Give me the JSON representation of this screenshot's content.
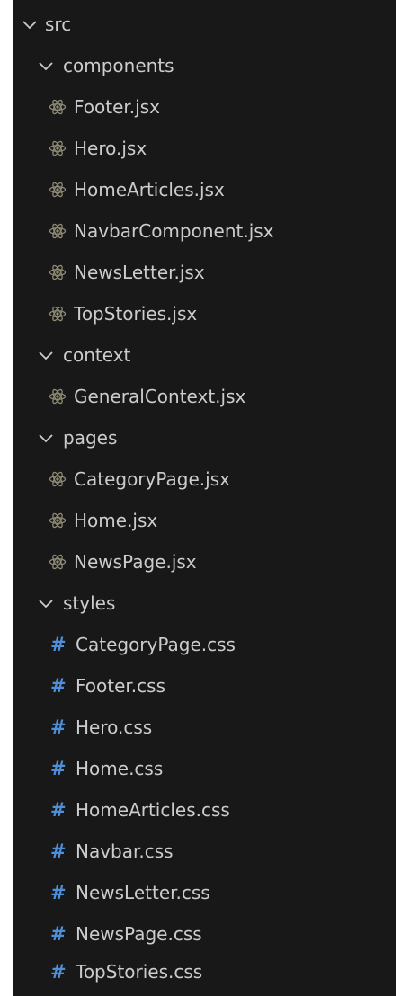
{
  "colors": {
    "background": "#181818",
    "text": "#cccccc",
    "react_icon": "#8f8b74",
    "css_icon": "#4f8fd9"
  },
  "tree": {
    "root": {
      "label": "src",
      "icon": "chevron-down-icon"
    },
    "components": {
      "label": "components",
      "icon": "chevron-down-icon",
      "files": [
        {
          "label": "Footer.jsx",
          "icon": "react-icon"
        },
        {
          "label": "Hero.jsx",
          "icon": "react-icon"
        },
        {
          "label": "HomeArticles.jsx",
          "icon": "react-icon"
        },
        {
          "label": "NavbarComponent.jsx",
          "icon": "react-icon"
        },
        {
          "label": "NewsLetter.jsx",
          "icon": "react-icon"
        },
        {
          "label": "TopStories.jsx",
          "icon": "react-icon"
        }
      ]
    },
    "context": {
      "label": "context",
      "icon": "chevron-down-icon",
      "files": [
        {
          "label": "GeneralContext.jsx",
          "icon": "react-icon"
        }
      ]
    },
    "pages": {
      "label": "pages",
      "icon": "chevron-down-icon",
      "files": [
        {
          "label": "CategoryPage.jsx",
          "icon": "react-icon"
        },
        {
          "label": "Home.jsx",
          "icon": "react-icon"
        },
        {
          "label": "NewsPage.jsx",
          "icon": "react-icon"
        }
      ]
    },
    "styles": {
      "label": "styles",
      "icon": "chevron-down-icon",
      "hash_glyph": "#",
      "files": [
        {
          "label": "CategoryPage.css",
          "icon": "css-hash-icon"
        },
        {
          "label": "Footer.css",
          "icon": "css-hash-icon"
        },
        {
          "label": "Hero.css",
          "icon": "css-hash-icon"
        },
        {
          "label": "Home.css",
          "icon": "css-hash-icon"
        },
        {
          "label": "HomeArticles.css",
          "icon": "css-hash-icon"
        },
        {
          "label": "Navbar.css",
          "icon": "css-hash-icon"
        },
        {
          "label": "NewsLetter.css",
          "icon": "css-hash-icon"
        },
        {
          "label": "NewsPage.css",
          "icon": "css-hash-icon"
        },
        {
          "label": "TopStories.css",
          "icon": "css-hash-icon"
        }
      ]
    }
  }
}
